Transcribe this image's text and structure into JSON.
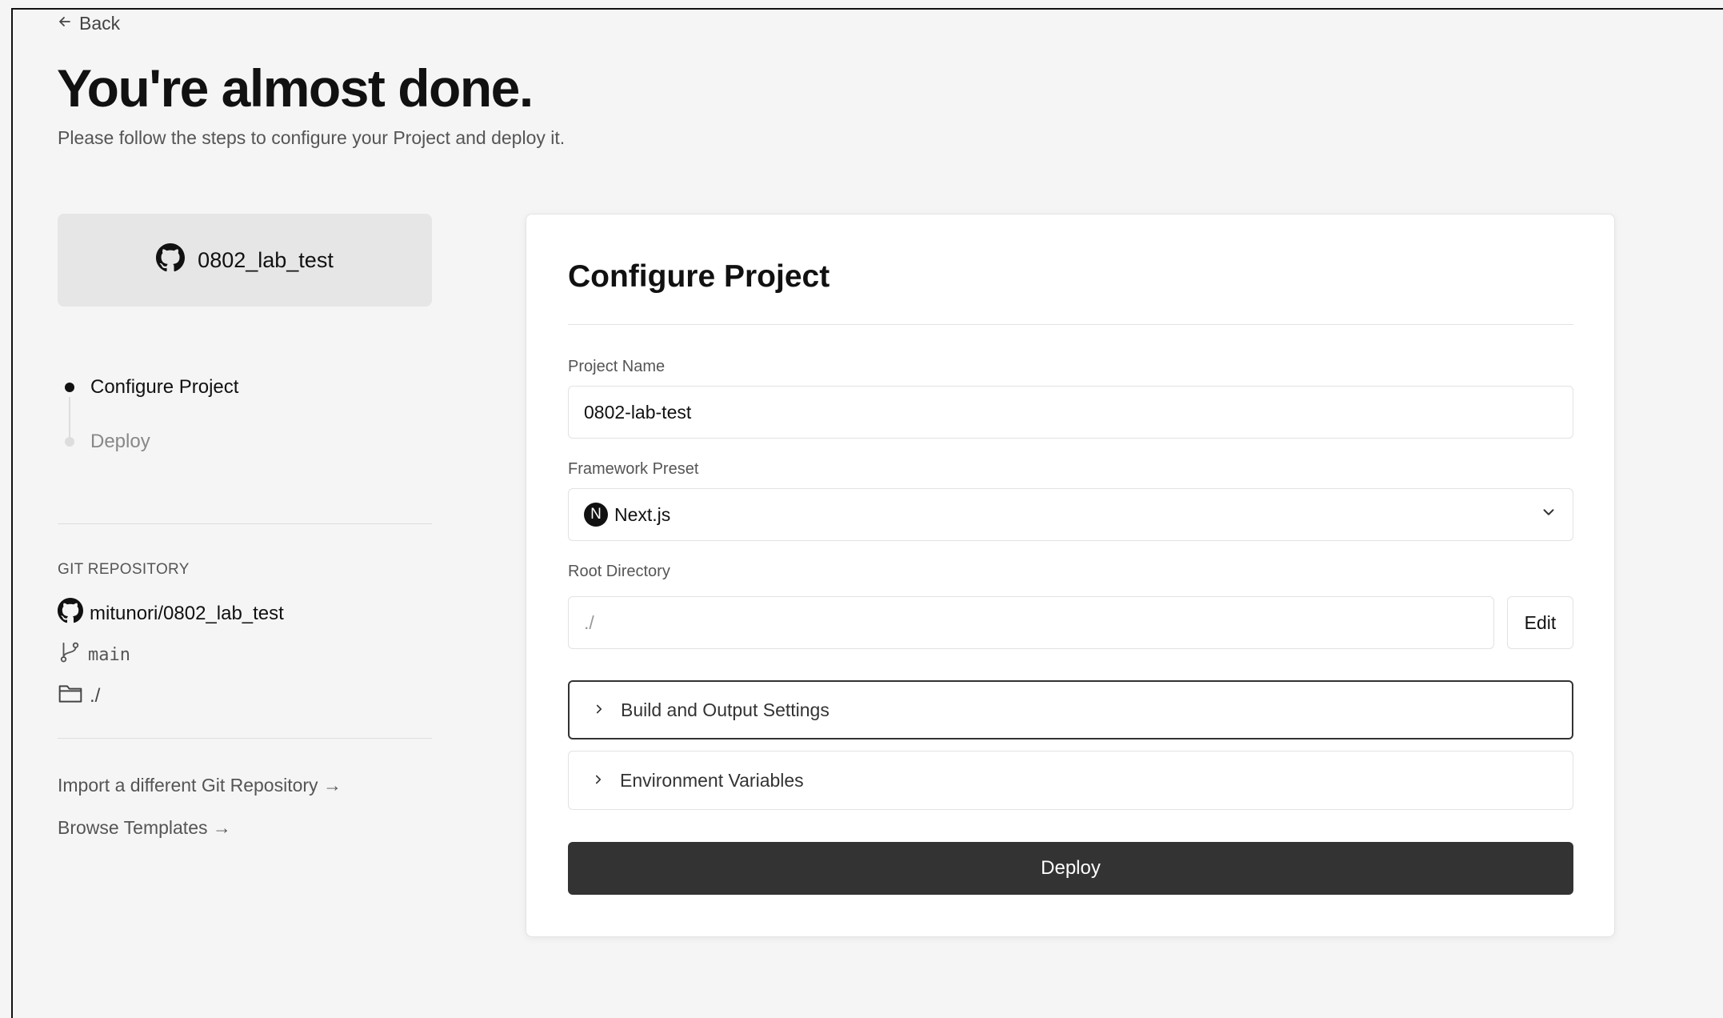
{
  "header": {
    "back_label": "Back",
    "title": "You're almost done.",
    "subtitle": "Please follow the steps to configure your Project and deploy it."
  },
  "repo_card": {
    "name": "0802_lab_test"
  },
  "steps": [
    {
      "label": "Configure Project",
      "state": "active"
    },
    {
      "label": "Deploy",
      "state": "pending"
    }
  ],
  "git": {
    "heading": "GIT REPOSITORY",
    "repo": "mitunori/0802_lab_test",
    "branch": "main",
    "directory": "./"
  },
  "links": {
    "import_label": "Import a different Git Repository →",
    "templates_label": "Browse Templates →"
  },
  "configure": {
    "title": "Configure Project",
    "project_name_label": "Project Name",
    "project_name_value": "0802-lab-test",
    "framework_label": "Framework Preset",
    "framework_value": "Next.js",
    "framework_logo_letter": "N",
    "root_dir_label": "Root Directory",
    "root_dir_value": "./",
    "edit_label": "Edit",
    "build_settings_label": "Build and Output Settings",
    "env_vars_label": "Environment Variables",
    "deploy_label": "Deploy"
  },
  "colors": {
    "deploy_button": "#333333",
    "background": "#f5f5f5",
    "card": "#ffffff"
  }
}
